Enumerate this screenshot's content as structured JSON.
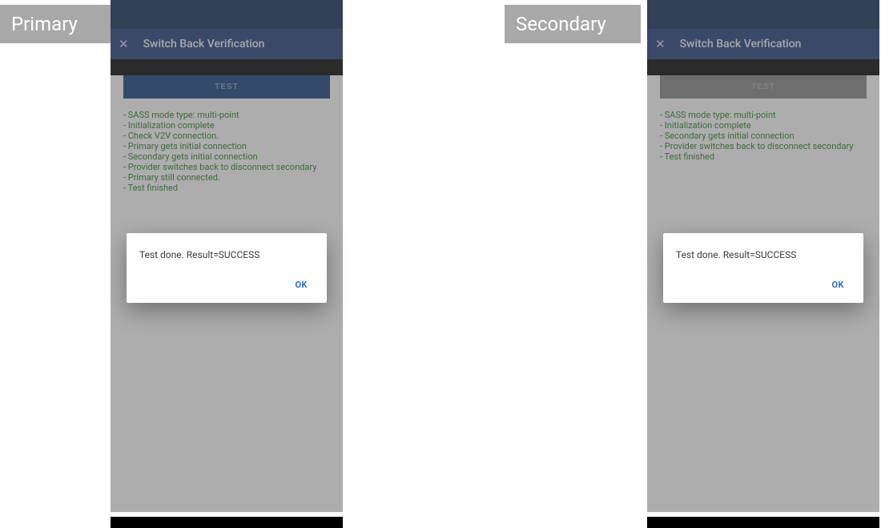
{
  "tags": {
    "primary": "Primary",
    "secondary": "Secondary"
  },
  "appbar": {
    "title": "Switch Back Verification"
  },
  "test_button": "TEST",
  "dialog": {
    "message": "Test done. Result=SUCCESS",
    "ok": "OK"
  },
  "primary_log": [
    "- SASS mode type: multi-point",
    "- Initialization complete",
    "- Check V2V connection.",
    "- Primary gets initial connection",
    "- Secondary gets initial connection",
    "- Provider switches back to disconnect secondary",
    "- Primary still connected.",
    "- Test finished"
  ],
  "secondary_log": [
    "- SASS mode type: multi-point",
    "- Initialization complete",
    "- Secondary gets initial connection",
    "- Provider switches back to disconnect secondary",
    "- Test finished"
  ]
}
